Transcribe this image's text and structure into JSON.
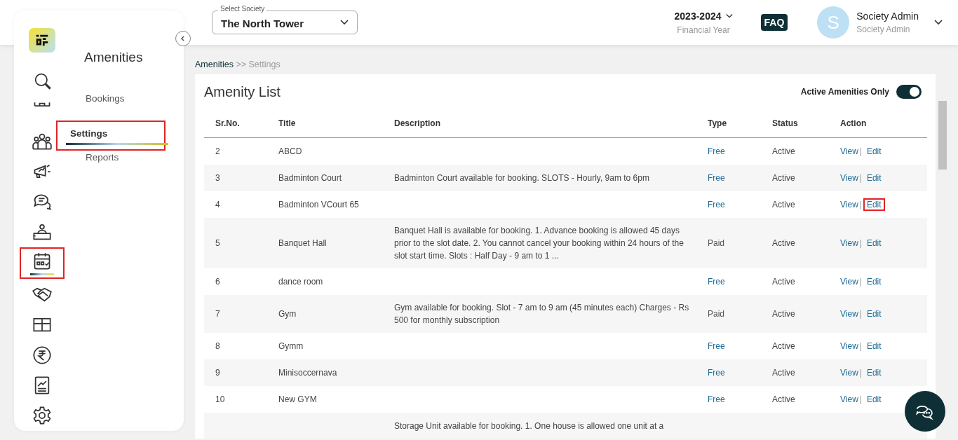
{
  "header": {
    "society_select": {
      "label": "Select Society",
      "value": "The North Tower"
    },
    "year": {
      "value": "2023-2024",
      "caption": "Financial Year"
    },
    "faq": "FAQ",
    "user": {
      "initial": "S",
      "name": "Society Admin",
      "role": "Society Admin"
    }
  },
  "nav_icons": [
    {
      "kind": "search",
      "selected": false,
      "highlighted": false
    },
    {
      "kind": "building",
      "selected": false,
      "highlighted": false
    },
    {
      "kind": "people",
      "selected": false,
      "highlighted": false
    },
    {
      "kind": "megaphone",
      "selected": false,
      "highlighted": false
    },
    {
      "kind": "chat",
      "selected": false,
      "highlighted": false
    },
    {
      "kind": "desk",
      "selected": false,
      "highlighted": false
    },
    {
      "kind": "calendar",
      "selected": true,
      "highlighted": true
    },
    {
      "kind": "handshake",
      "selected": false,
      "highlighted": false
    },
    {
      "kind": "box",
      "selected": false,
      "highlighted": false
    },
    {
      "kind": "rupee",
      "selected": false,
      "highlighted": false
    },
    {
      "kind": "report",
      "selected": false,
      "highlighted": false
    },
    {
      "kind": "gear",
      "selected": false,
      "highlighted": false
    }
  ],
  "submenu": {
    "title": "Amenities",
    "items": [
      {
        "label": "Bookings",
        "selected": false,
        "highlighted": false
      },
      {
        "label": "Settings",
        "selected": true,
        "highlighted": true
      },
      {
        "label": "Reports",
        "selected": false,
        "highlighted": false
      }
    ]
  },
  "breadcrumb": [
    "Amenities",
    ">>",
    "Settings"
  ],
  "card": {
    "title": "Amenity List",
    "toggle": {
      "label": "Active Amenities Only",
      "on": true
    }
  },
  "table": {
    "columns": [
      "Sr.No.",
      "Title",
      "Description",
      "Type",
      "Status",
      "Action"
    ],
    "rows": [
      {
        "sr": "2",
        "title": "ABCD",
        "type": "Free",
        "kind": "free",
        "status": "Active",
        "view": "View",
        "separator": "|",
        "edit": "Edit",
        "edit_highlighted": false
      },
      {
        "sr": "3",
        "title": "Badminton Court",
        "description": "Badminton Court available for booking. SLOTS - Hourly, 9am to 6pm",
        "type": "Free",
        "kind": "free",
        "status": "Active",
        "view": "View",
        "separator": "|",
        "edit": "Edit",
        "edit_highlighted": false
      },
      {
        "sr": "4",
        "title": "Badminton VCourt 65",
        "type": "Free",
        "kind": "free",
        "status": "Active",
        "view": "View",
        "separator": "|",
        "edit": "Edit",
        "edit_highlighted": true
      },
      {
        "sr": "5",
        "title": "Banquet Hall",
        "description": "Banquet Hall is available for booking.  1. Advance booking is allowed 45 days prior to the slot date. 2. You cannot cancel your booking within 24 hours of the slot start time. Slots :  Half Day - 9 am to 1 ...",
        "type": "Paid",
        "kind": "paid",
        "status": "Active",
        "view": "View",
        "separator": "|",
        "edit": "Edit",
        "edit_highlighted": false
      },
      {
        "sr": "6",
        "title": "dance room",
        "type": "Free",
        "kind": "free",
        "status": "Active",
        "view": "View",
        "separator": "|",
        "edit": "Edit",
        "edit_highlighted": false
      },
      {
        "sr": "7",
        "title": "Gym",
        "description": "Gym available for booking. Slot - 7 am to 9 am (45 minutes each) Charges - Rs 500 for monthly subscription",
        "type": "Paid",
        "kind": "paid",
        "status": "Active",
        "view": "View",
        "separator": "|",
        "edit": "Edit",
        "edit_highlighted": false
      },
      {
        "sr": "8",
        "title": "Gymm",
        "type": "Free",
        "kind": "free",
        "status": "Active",
        "view": "View",
        "separator": "|",
        "edit": "Edit",
        "edit_highlighted": false
      },
      {
        "sr": "9",
        "title": "Minisoccernava",
        "type": "Free",
        "kind": "free",
        "status": "Active",
        "view": "View",
        "separator": "|",
        "edit": "Edit",
        "edit_highlighted": false
      },
      {
        "sr": "10",
        "title": "New GYM",
        "type": "Free",
        "kind": "free",
        "status": "Active",
        "view": "View",
        "separator": "|",
        "edit": "Edit",
        "edit_highlighted": false
      },
      {
        "description": "Storage Unit available for booking. 1. One house is allowed one unit at a"
      }
    ]
  }
}
